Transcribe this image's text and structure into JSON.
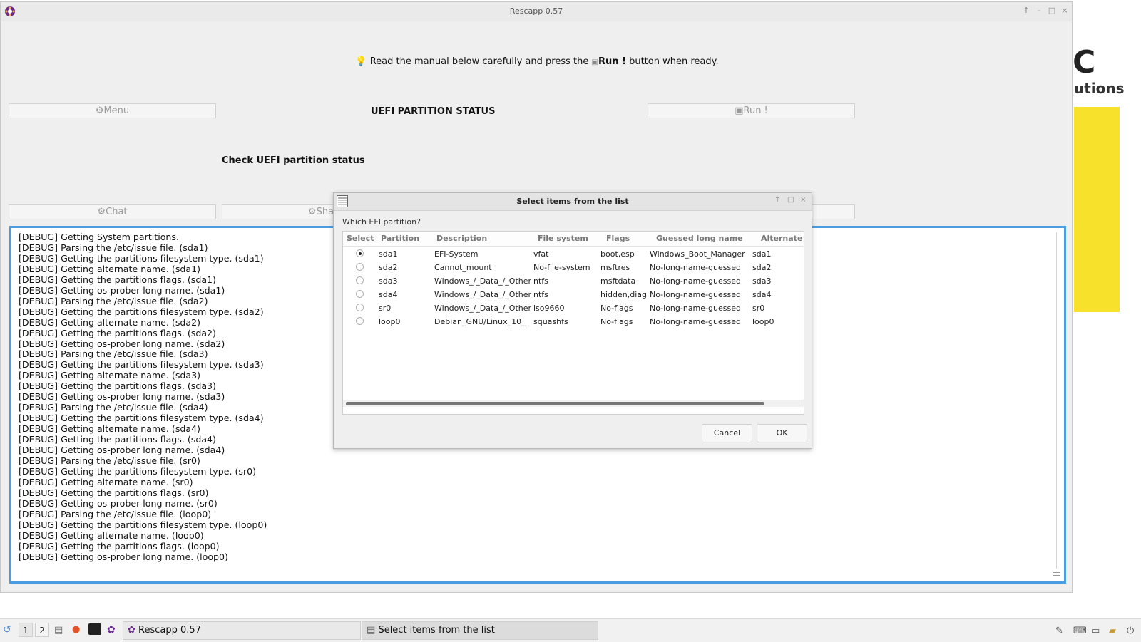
{
  "background_app": {
    "logo_letter": "C",
    "logo_sub": "utions"
  },
  "main_window": {
    "title": "Rescapp 0.57",
    "titlebar_buttons": [
      "↑",
      "–",
      "□",
      "×"
    ],
    "instruction_prefix": "Read the manual below carefully and press the",
    "instruction_run": "Run !",
    "instruction_suffix": "button when ready.",
    "menu_button": "Menu",
    "section_title": "UEFI PARTITION STATUS",
    "run_button": "Run !",
    "subtitle": "Check UEFI partition status",
    "chat_button": "Chat",
    "share_button": "Share",
    "log_lines": [
      "[DEBUG] Getting System partitions.",
      "[DEBUG] Parsing the /etc/issue file. (sda1)",
      "[DEBUG] Getting the partitions filesystem type. (sda1)",
      "[DEBUG] Getting alternate name. (sda1)",
      "[DEBUG] Getting the partitions flags. (sda1)",
      "[DEBUG] Getting os-prober long name. (sda1)",
      "[DEBUG] Parsing the /etc/issue file. (sda2)",
      "[DEBUG] Getting the partitions filesystem type. (sda2)",
      "[DEBUG] Getting alternate name. (sda2)",
      "[DEBUG] Getting the partitions flags. (sda2)",
      "[DEBUG] Getting os-prober long name. (sda2)",
      "[DEBUG] Parsing the /etc/issue file. (sda3)",
      "[DEBUG] Getting the partitions filesystem type. (sda3)",
      "[DEBUG] Getting alternate name. (sda3)",
      "[DEBUG] Getting the partitions flags. (sda3)",
      "[DEBUG] Getting os-prober long name. (sda3)",
      "[DEBUG] Parsing the /etc/issue file. (sda4)",
      "[DEBUG] Getting the partitions filesystem type. (sda4)",
      "[DEBUG] Getting alternate name. (sda4)",
      "[DEBUG] Getting the partitions flags. (sda4)",
      "[DEBUG] Getting os-prober long name. (sda4)",
      "[DEBUG] Parsing the /etc/issue file. (sr0)",
      "[DEBUG] Getting the partitions filesystem type. (sr0)",
      "[DEBUG] Getting alternate name. (sr0)",
      "[DEBUG] Getting the partitions flags. (sr0)",
      "[DEBUG] Getting os-prober long name. (sr0)",
      "[DEBUG] Parsing the /etc/issue file. (loop0)",
      "[DEBUG] Getting the partitions filesystem type. (loop0)",
      "[DEBUG] Getting alternate name. (loop0)",
      "[DEBUG] Getting the partitions flags. (loop0)",
      "[DEBUG] Getting os-prober long name. (loop0)"
    ]
  },
  "dialog": {
    "title": "Select items from the list",
    "question": "Which EFI partition?",
    "columns": [
      "Select",
      "Partition",
      "Description",
      "File system",
      "Flags",
      "Guessed long name",
      "Alternate"
    ],
    "rows": [
      {
        "selected": true,
        "partition": "sda1",
        "description": "EFI-System",
        "fs": "vfat",
        "flags": "boot,esp",
        "long_name": "Windows_Boot_Manager",
        "alternate": "sda1"
      },
      {
        "selected": false,
        "partition": "sda2",
        "description": "Cannot_mount",
        "fs": "No-file-system",
        "flags": "msftres",
        "long_name": "No-long-name-guessed",
        "alternate": "sda2"
      },
      {
        "selected": false,
        "partition": "sda3",
        "description": "Windows_/_Data_/_Other",
        "fs": "ntfs",
        "flags": "msftdata",
        "long_name": "No-long-name-guessed",
        "alternate": "sda3"
      },
      {
        "selected": false,
        "partition": "sda4",
        "description": "Windows_/_Data_/_Other",
        "fs": "ntfs",
        "flags": "hidden,diag",
        "long_name": "No-long-name-guessed",
        "alternate": "sda4"
      },
      {
        "selected": false,
        "partition": "sr0",
        "description": "Windows_/_Data_/_Other",
        "fs": "iso9660",
        "flags": "No-flags",
        "long_name": "No-long-name-guessed",
        "alternate": "sr0"
      },
      {
        "selected": false,
        "partition": "loop0",
        "description": "Debian_GNU/Linux_10_",
        "fs": "squashfs",
        "flags": "No-flags",
        "long_name": "No-long-name-guessed",
        "alternate": "loop0"
      }
    ],
    "cancel_button": "Cancel",
    "ok_button": "OK"
  },
  "taskbar": {
    "workspaces": [
      "1",
      "2"
    ],
    "tasks": [
      {
        "label": "Rescapp 0.57"
      },
      {
        "label": "Select items from the list"
      }
    ]
  },
  "colors": {
    "focus_border": "#4a9de0",
    "accent_yellow": "#f7e12b"
  }
}
